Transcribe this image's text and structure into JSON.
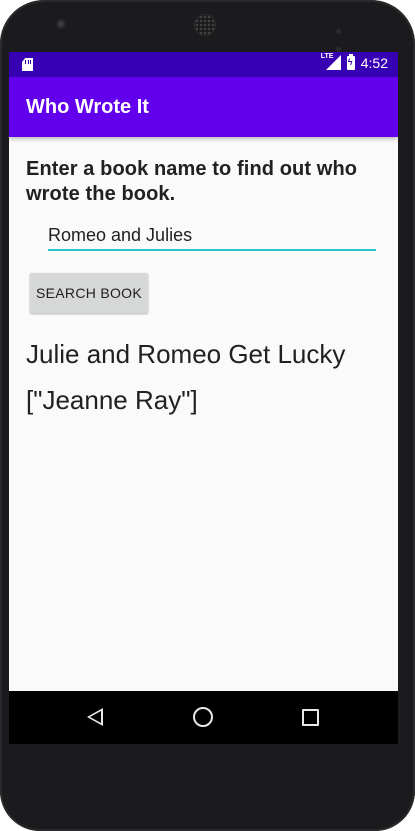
{
  "status_bar": {
    "network_label": "LTE",
    "time": "4:52",
    "icons": [
      "sd-card-icon",
      "lte-signal-icon",
      "battery-charging-icon"
    ]
  },
  "app_bar": {
    "title": "Who Wrote It"
  },
  "form": {
    "prompt": "Enter a book name to find out who wrote the book.",
    "search_value": "Romeo and Julies",
    "button_label": "SEARCH BOOK"
  },
  "result": {
    "title": "Julie and Romeo Get Lucky",
    "authors": "[\"Jeanne Ray\"]"
  },
  "colors": {
    "status_bar": "#3700b3",
    "app_bar": "#6200ee",
    "input_underline": "#26c6c6",
    "button": "#d6d7d7"
  },
  "navigation": {
    "buttons": [
      "back-icon",
      "home-icon",
      "recents-icon"
    ]
  }
}
